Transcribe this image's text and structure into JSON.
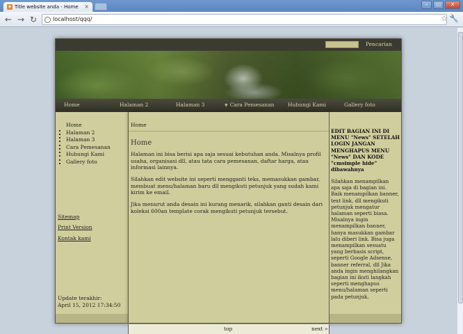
{
  "browser": {
    "tab_title": "Title website anda - Home",
    "tab_close": "×",
    "url": "localhost/qqq/",
    "back": "←",
    "forward": "→",
    "reload": "↻",
    "star": "☆",
    "wrench": "🔧",
    "win_min": "–",
    "win_max": "▭",
    "win_close": "✕"
  },
  "header": {
    "search_label": "Pencarian"
  },
  "nav": {
    "items": [
      {
        "label": "Home"
      },
      {
        "label": "Halaman 2"
      },
      {
        "label": "Halaman 3"
      },
      {
        "label": "Cara Pemesanan",
        "caret": "▼"
      },
      {
        "label": "Hubungi Kami"
      },
      {
        "label": "Gallery foto"
      }
    ]
  },
  "sidebar": {
    "menu": [
      {
        "label": "Home"
      },
      {
        "label": "Halaman 2"
      },
      {
        "label": "Halaman 3"
      },
      {
        "label": "Cara Pemesanan"
      },
      {
        "label": "Hubungi Kami"
      },
      {
        "label": "Gallery foto"
      }
    ],
    "sitemap": "Sitemap",
    "print": "Print Version",
    "contact": "Kontak kami",
    "updated_label": "Update terakhir:",
    "updated_value": "April 15, 2012 17:34:50"
  },
  "main": {
    "breadcrumb": "Home",
    "title": "Home",
    "paragraphs": [
      "Halaman ini bisa berisi apa saja sesuai kebutuhan anda. Misalnya profil usaha, organisasi dll, atau tata cara pemesanan, daftar harga, atau informasi lainnya.",
      "Silahkan edit website ini seperti mengganti teks, memasukkan gambar, membuat menu/halaman baru dll mengikuti petunjuk yang sudah kami kirim ke email.",
      "Jika menurut anda desain ini kurang menarik, silahkan ganti desain dari koleksi 600an template corak mengikuti petunjuk tersebut."
    ],
    "top_link": "top",
    "next_link": "next »"
  },
  "right": {
    "heading": "EDIT BAGIAN INI DI MENU \"News\" SETELAH LOGIN JANGAN MENGHAPUS MENU \"News\" DAN KODE \"cmsimple hide\" dibawahnya",
    "body": "Silahkan menampilkan apa saja di bagian ini. Baik menampilkan banner, text link, dll mengikuti petunjuk mengatur halaman seperti biasa. Misalnya ingin menampilkan banner, hanya masukkan gambar lalu diberi link. Bisa juga menampilkan sesuatu yang berbasis script, seperti Google Adsense, banner referral, dll Jika anda ingin menghilangkan bagian ini ikuti langkah seperti menghapus menu/halaman seperti pada petunjuk."
  }
}
